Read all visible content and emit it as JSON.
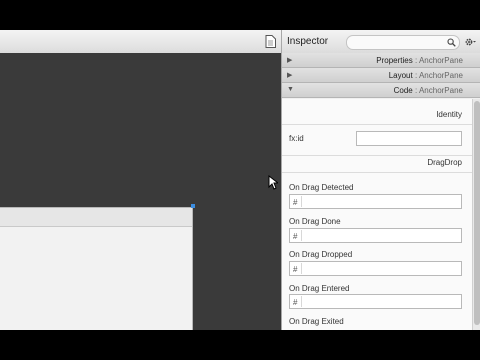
{
  "inspector": {
    "title": "Inspector",
    "search_placeholder": "",
    "sections": [
      {
        "name": "Properties",
        "suffix": " : AnchorPane",
        "expanded": false
      },
      {
        "name": "Layout",
        "suffix": " : AnchorPane",
        "expanded": false
      },
      {
        "name": "Code",
        "suffix": " : AnchorPane",
        "expanded": true
      }
    ],
    "identity_group": "Identity",
    "fxid_label": "fx:id",
    "fxid_value": "",
    "dragdrop_group": "DragDrop",
    "hash": "#",
    "events": [
      "On Drag Detected",
      "On Drag Done",
      "On Drag Dropped",
      "On Drag Entered",
      "On Drag Exited"
    ]
  },
  "icons": {
    "document": "document-icon",
    "search": "search-icon",
    "settings": "gear-icon",
    "cursor": "mouse-pointer-icon"
  },
  "colors": {
    "canvas": "#3a3a3a",
    "selection_handle": "#3b8de0",
    "panel": "#f0f0f0"
  }
}
